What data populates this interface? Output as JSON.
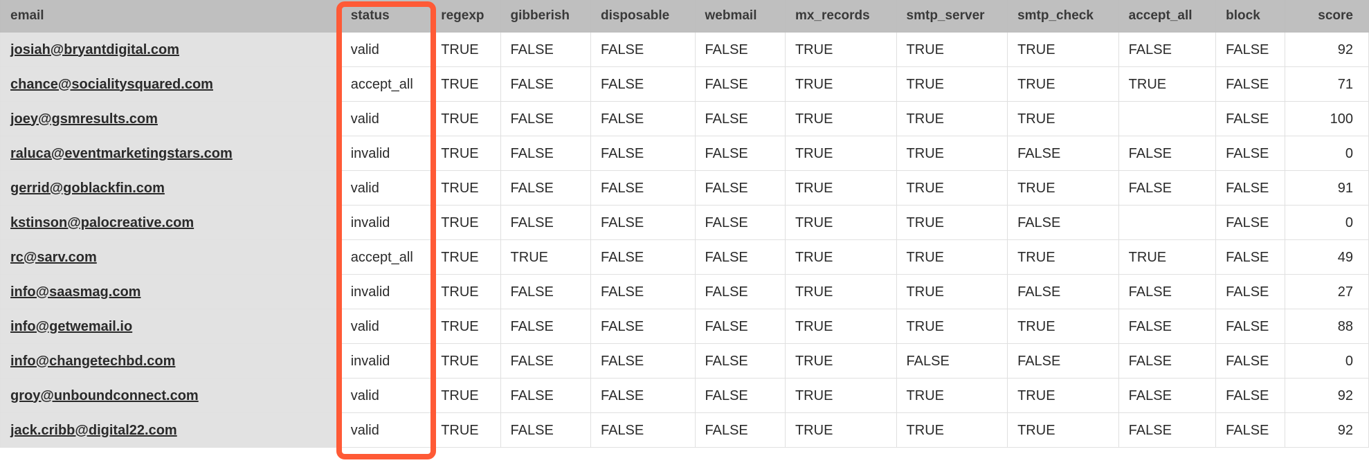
{
  "columns": {
    "email": "email",
    "status": "status",
    "regexp": "regexp",
    "gibberish": "gibberish",
    "disposable": "disposable",
    "webmail": "webmail",
    "mx_records": "mx_records",
    "smtp_server": "smtp_server",
    "smtp_check": "smtp_check",
    "accept_all": "accept_all",
    "block": "block",
    "score": "score"
  },
  "rows": [
    {
      "email": "josiah@bryantdigital.com",
      "status": "valid",
      "regexp": "TRUE",
      "gibberish": "FALSE",
      "disposable": "FALSE",
      "webmail": "FALSE",
      "mx_records": "TRUE",
      "smtp_server": "TRUE",
      "smtp_check": "TRUE",
      "accept_all": "FALSE",
      "block": "FALSE",
      "score": "92"
    },
    {
      "email": "chance@socialitysquared.com",
      "status": "accept_all",
      "regexp": "TRUE",
      "gibberish": "FALSE",
      "disposable": "FALSE",
      "webmail": "FALSE",
      "mx_records": "TRUE",
      "smtp_server": "TRUE",
      "smtp_check": "TRUE",
      "accept_all": "TRUE",
      "block": "FALSE",
      "score": "71"
    },
    {
      "email": "joey@gsmresults.com",
      "status": "valid",
      "regexp": "TRUE",
      "gibberish": "FALSE",
      "disposable": "FALSE",
      "webmail": "FALSE",
      "mx_records": "TRUE",
      "smtp_server": "TRUE",
      "smtp_check": "TRUE",
      "accept_all": "",
      "block": "FALSE",
      "score": "100"
    },
    {
      "email": "raluca@eventmarketingstars.com",
      "status": "invalid",
      "regexp": "TRUE",
      "gibberish": "FALSE",
      "disposable": "FALSE",
      "webmail": "FALSE",
      "mx_records": "TRUE",
      "smtp_server": "TRUE",
      "smtp_check": "FALSE",
      "accept_all": "FALSE",
      "block": "FALSE",
      "score": "0"
    },
    {
      "email": "gerrid@goblackfin.com",
      "status": "valid",
      "regexp": "TRUE",
      "gibberish": "FALSE",
      "disposable": "FALSE",
      "webmail": "FALSE",
      "mx_records": "TRUE",
      "smtp_server": "TRUE",
      "smtp_check": "TRUE",
      "accept_all": "FALSE",
      "block": "FALSE",
      "score": "91"
    },
    {
      "email": "kstinson@palocreative.com",
      "status": "invalid",
      "regexp": "TRUE",
      "gibberish": "FALSE",
      "disposable": "FALSE",
      "webmail": "FALSE",
      "mx_records": "TRUE",
      "smtp_server": "TRUE",
      "smtp_check": "FALSE",
      "accept_all": "",
      "block": "FALSE",
      "score": "0"
    },
    {
      "email": "rc@sarv.com",
      "status": "accept_all",
      "regexp": "TRUE",
      "gibberish": "TRUE",
      "disposable": "FALSE",
      "webmail": "FALSE",
      "mx_records": "TRUE",
      "smtp_server": "TRUE",
      "smtp_check": "TRUE",
      "accept_all": "TRUE",
      "block": "FALSE",
      "score": "49"
    },
    {
      "email": "info@saasmag.com",
      "status": "invalid",
      "regexp": "TRUE",
      "gibberish": "FALSE",
      "disposable": "FALSE",
      "webmail": "FALSE",
      "mx_records": "TRUE",
      "smtp_server": "TRUE",
      "smtp_check": "FALSE",
      "accept_all": "FALSE",
      "block": "FALSE",
      "score": "27"
    },
    {
      "email": "info@getwemail.io",
      "status": "valid",
      "regexp": "TRUE",
      "gibberish": "FALSE",
      "disposable": "FALSE",
      "webmail": "FALSE",
      "mx_records": "TRUE",
      "smtp_server": "TRUE",
      "smtp_check": "TRUE",
      "accept_all": "FALSE",
      "block": "FALSE",
      "score": "88"
    },
    {
      "email": "info@changetechbd.com",
      "status": "invalid",
      "regexp": "TRUE",
      "gibberish": "FALSE",
      "disposable": "FALSE",
      "webmail": "FALSE",
      "mx_records": "TRUE",
      "smtp_server": "FALSE",
      "smtp_check": "FALSE",
      "accept_all": "FALSE",
      "block": "FALSE",
      "score": "0"
    },
    {
      "email": "groy@unboundconnect.com",
      "status": "valid",
      "regexp": "TRUE",
      "gibberish": "FALSE",
      "disposable": "FALSE",
      "webmail": "FALSE",
      "mx_records": "TRUE",
      "smtp_server": "TRUE",
      "smtp_check": "TRUE",
      "accept_all": "FALSE",
      "block": "FALSE",
      "score": "92"
    },
    {
      "email": "jack.cribb@digital22.com",
      "status": "valid",
      "regexp": "TRUE",
      "gibberish": "FALSE",
      "disposable": "FALSE",
      "webmail": "FALSE",
      "mx_records": "TRUE",
      "smtp_server": "TRUE",
      "smtp_check": "TRUE",
      "accept_all": "FALSE",
      "block": "FALSE",
      "score": "92"
    }
  ],
  "highlight": {
    "column": "status"
  }
}
